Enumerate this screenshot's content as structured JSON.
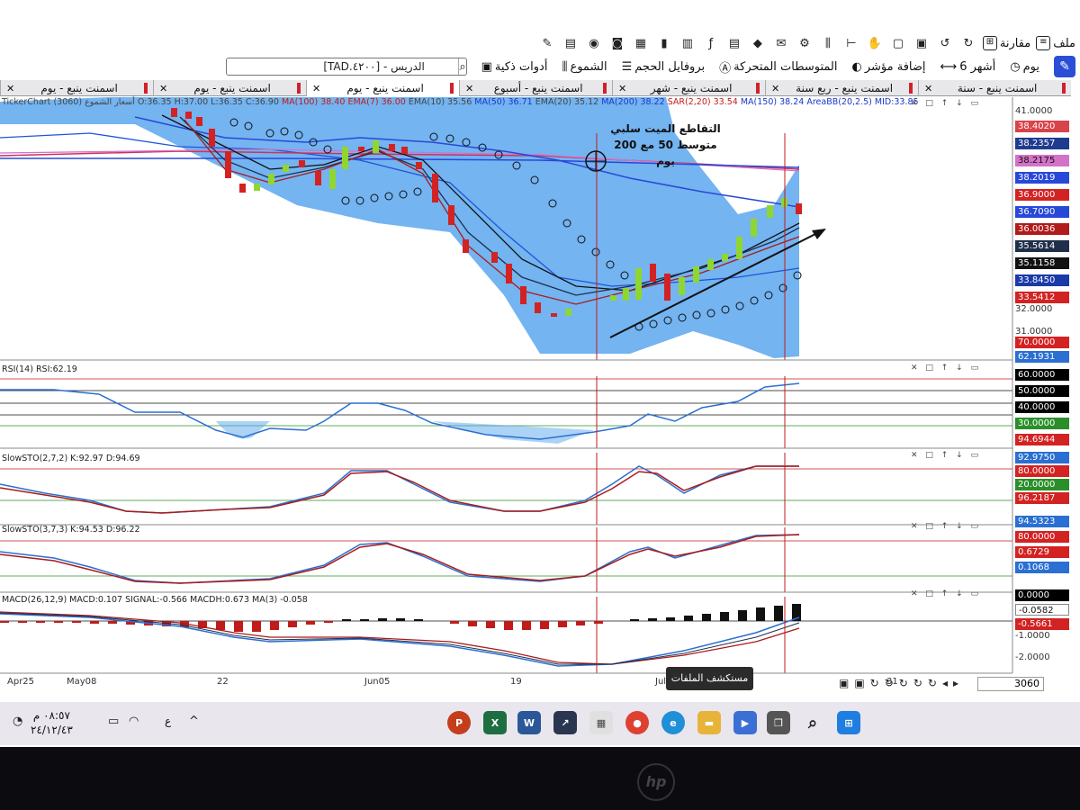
{
  "toolbar": {
    "file_label": "ملف",
    "compare_label": "مقارنة",
    "day_label": "يوم",
    "six_months_label": "6 أشهر",
    "add_indicator_label": "إضافة مؤشر",
    "moving_averages_label": "المتوسطات المتحركة",
    "volume_profile_label": "بروفايل الحجم",
    "candles_label": "الشموع",
    "smart_tools_label": "أدوات ذكية",
    "search_value": "[TAD.٤٢٠٠] - الدريس"
  },
  "tabs": [
    {
      "label": "اسمنت ينبع - سنة"
    },
    {
      "label": "اسمنت ينبع - ربع سنة"
    },
    {
      "label": "اسمنت ينبع - شهر"
    },
    {
      "label": "اسمنت ينبع - أسبوع"
    },
    {
      "label": "اسمنت ينبع - يوم"
    },
    {
      "label": "اسمنت ينبع - يوم"
    },
    {
      "label": "اسمنت ينبع - يوم"
    }
  ],
  "legends": {
    "price": {
      "brand": "TickerChart",
      "ohlc": "أسعار الشموع (3060) O:36.35 H:37.00 L:36.35 C:36.90",
      "ma100": "MA(100) 38.40",
      "ema7": "EMA(7) 36.00",
      "ema10": "EMA(10) 35.56",
      "ma50": "MA(50) 36.71",
      "ema20": "EMA(20) 35.12",
      "ma200": "MA(200) 38.22",
      "sar": "SAR(2,20) 33.54",
      "ma150": "MA(150) 38.24",
      "bb": "AreaBB(20,2.5) MID:33.85"
    },
    "rsi": "RSI(14) RSI:62.19",
    "sto1": "SlowSTO(2,7,2) K:92.97 D:94.69",
    "sto2": "SlowSTO(3,7,3) K:94.53 D:96.22",
    "macd": "MACD(26,12,9) MACD:0.107 SIGNAL:-0.566 MACDH:0.673 MA(3) -0.058"
  },
  "annotation": {
    "line1": "التقاطع الميت سلبي",
    "line2": "متوسط 50 مع 200 يوم"
  },
  "price_scale": {
    "top": "41.0000",
    "mid": "32.0000",
    "low": "31.0000"
  },
  "price_labels": [
    {
      "text": "38.4020",
      "color": "#d9434a"
    },
    {
      "text": "38.2357",
      "color": "#1f3b8f"
    },
    {
      "text": "38.2175",
      "color": "#d472c8"
    },
    {
      "text": "38.2019",
      "color": "#2848d8"
    },
    {
      "text": "36.9000",
      "color": "#d32222"
    },
    {
      "text": "36.7090",
      "color": "#2848d8"
    },
    {
      "text": "36.0036",
      "color": "#b21b1b"
    },
    {
      "text": "35.5614",
      "color": "#1f2f4a"
    },
    {
      "text": "35.1158",
      "color": "#111111"
    },
    {
      "text": "33.8450",
      "color": "#1a3aa8"
    },
    {
      "text": "33.5412",
      "color": "#d32222"
    },
    {
      "text": "70.0000",
      "color": "#d32222"
    },
    {
      "text": "62.1931",
      "color": "#2a6fd1"
    }
  ],
  "rsi_labels": [
    {
      "text": "60.0000",
      "color": "#000000"
    },
    {
      "text": "50.0000",
      "color": "#000000"
    },
    {
      "text": "40.0000",
      "color": "#000000"
    },
    {
      "text": "30.0000",
      "color": "#2a8f2a"
    },
    {
      "text": "94.6944",
      "color": "#d32222"
    }
  ],
  "sto1_labels": [
    {
      "text": "92.9750",
      "color": "#2a6fd1"
    },
    {
      "text": "80.0000",
      "color": "#d32222"
    },
    {
      "text": "20.0000",
      "color": "#2a8f2a"
    },
    {
      "text": "96.2187",
      "color": "#d32222"
    }
  ],
  "sto2_labels": [
    {
      "text": "94.5323",
      "color": "#2a6fd1"
    },
    {
      "text": "80.0000",
      "color": "#d32222"
    },
    {
      "text": "0.6729",
      "color": "#d32222"
    },
    {
      "text": "0.1068",
      "color": "#2a6fd1"
    }
  ],
  "macd_labels": [
    {
      "text": "0.0000",
      "color": "#000000"
    },
    {
      "text": "-0.0582",
      "color": "#ffffff"
    },
    {
      "text": "-0.5661",
      "color": "#d32222"
    }
  ],
  "macd_scale": {
    "low1": "-1.0000",
    "low2": "-2.0000"
  },
  "dates": [
    "Apr25",
    "May08",
    "22",
    "Jun05",
    "19",
    "Jul",
    "31"
  ],
  "tooltip": "مستكشف الملفات",
  "bottom_count": "3060",
  "clock": {
    "time": "٠٨:٥٧ م",
    "date": "٢٤/١٢/٤٣"
  },
  "lang_indicator": "ع",
  "taskbar_apps": [
    "powerpoint-icon",
    "excel-icon",
    "word-icon",
    "tickerchart-icon",
    "store-icon",
    "chrome-icon",
    "edge-icon",
    "file-explorer-icon",
    "media-icon",
    "windows-icon",
    "search-icon",
    "start-icon"
  ],
  "brand_logo": "hp"
}
